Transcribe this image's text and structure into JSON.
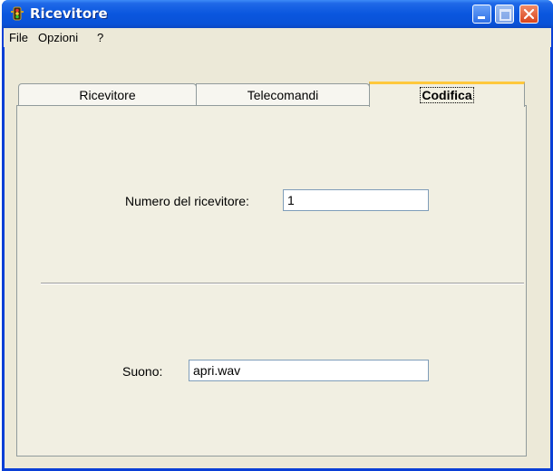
{
  "window": {
    "title": "Ricevitore",
    "icon": "traffic-light-icon",
    "controls": [
      "minimize",
      "maximize",
      "close"
    ]
  },
  "menu": {
    "items": [
      "File",
      "Opzioni",
      "?"
    ]
  },
  "tabs": [
    {
      "label": "Ricevitore",
      "selected": false
    },
    {
      "label": "Telecomandi",
      "selected": false
    },
    {
      "label": "Codifica",
      "selected": true
    }
  ],
  "form": {
    "receiver_number_label": "Numero del ricevitore:",
    "receiver_number_value": "1",
    "sound_label": "Suono:",
    "sound_value": "apri.wav"
  }
}
